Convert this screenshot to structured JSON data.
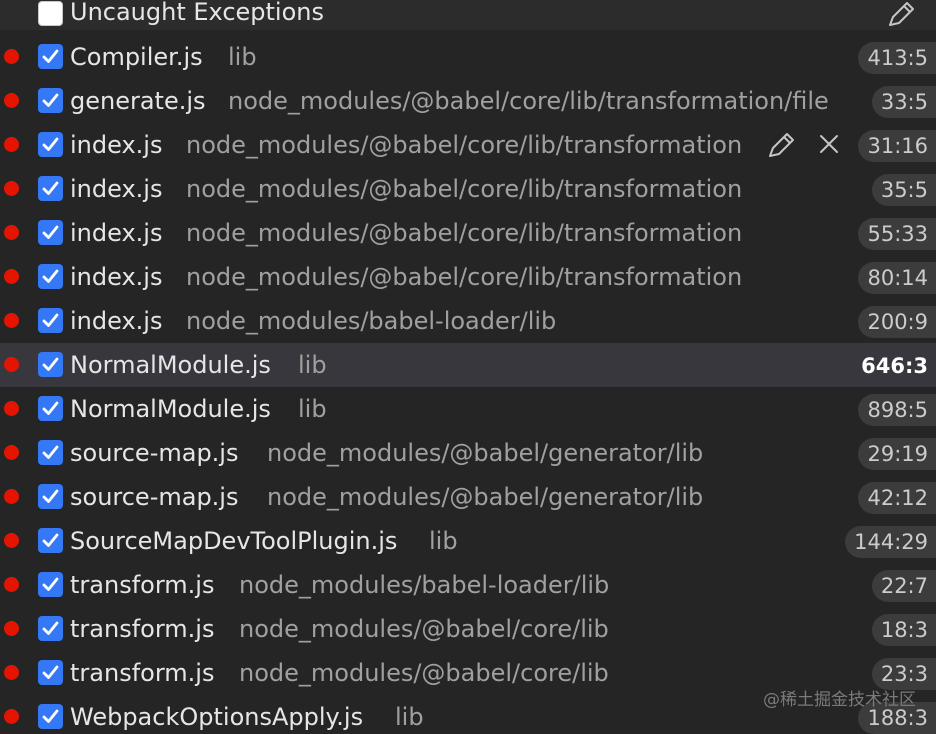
{
  "header": {
    "label": "Uncaught Exceptions",
    "edit_icon": "pencil-icon"
  },
  "row_actions": {
    "edit_icon": "pencil-icon",
    "remove_icon": "close-icon"
  },
  "colors": {
    "background": "#252526",
    "selected_row": "#37373d",
    "breakpoint": "#e51400",
    "checkbox": "#3478f6",
    "badge": "#3c3c3c"
  },
  "breakpoints": [
    {
      "file": "Compiler.js",
      "path": "lib",
      "location": "413:5",
      "checked": true
    },
    {
      "file": "generate.js",
      "path": "node_modules/@babel/core/lib/transformation/file",
      "location": "33:5",
      "checked": true
    },
    {
      "file": "index.js",
      "path": "node_modules/@babel/core/lib/transformation",
      "location": "31:16",
      "checked": true,
      "hovered": true
    },
    {
      "file": "index.js",
      "path": "node_modules/@babel/core/lib/transformation",
      "location": "35:5",
      "checked": true
    },
    {
      "file": "index.js",
      "path": "node_modules/@babel/core/lib/transformation",
      "location": "55:33",
      "checked": true
    },
    {
      "file": "index.js",
      "path": "node_modules/@babel/core/lib/transformation",
      "location": "80:14",
      "checked": true
    },
    {
      "file": "index.js",
      "path": "node_modules/babel-loader/lib",
      "location": "200:9",
      "checked": true
    },
    {
      "file": "NormalModule.js",
      "path": "lib",
      "location": "646:3",
      "checked": true,
      "selected": true
    },
    {
      "file": "NormalModule.js",
      "path": "lib",
      "location": "898:5",
      "checked": true
    },
    {
      "file": "source-map.js",
      "path": "node_modules/@babel/generator/lib",
      "location": "29:19",
      "checked": true
    },
    {
      "file": "source-map.js",
      "path": "node_modules/@babel/generator/lib",
      "location": "42:12",
      "checked": true
    },
    {
      "file": "SourceMapDevToolPlugin.js",
      "path": "lib",
      "location": "144:29",
      "checked": true
    },
    {
      "file": "transform.js",
      "path": "node_modules/babel-loader/lib",
      "location": "22:7",
      "checked": true
    },
    {
      "file": "transform.js",
      "path": "node_modules/@babel/core/lib",
      "location": "18:3",
      "checked": true
    },
    {
      "file": "transform.js",
      "path": "node_modules/@babel/core/lib",
      "location": "23:3",
      "checked": true
    },
    {
      "file": "WebpackOptionsApply.js",
      "path": "lib",
      "location": "188:3",
      "checked": true
    }
  ],
  "watermark": "@稀土掘金技术社区"
}
